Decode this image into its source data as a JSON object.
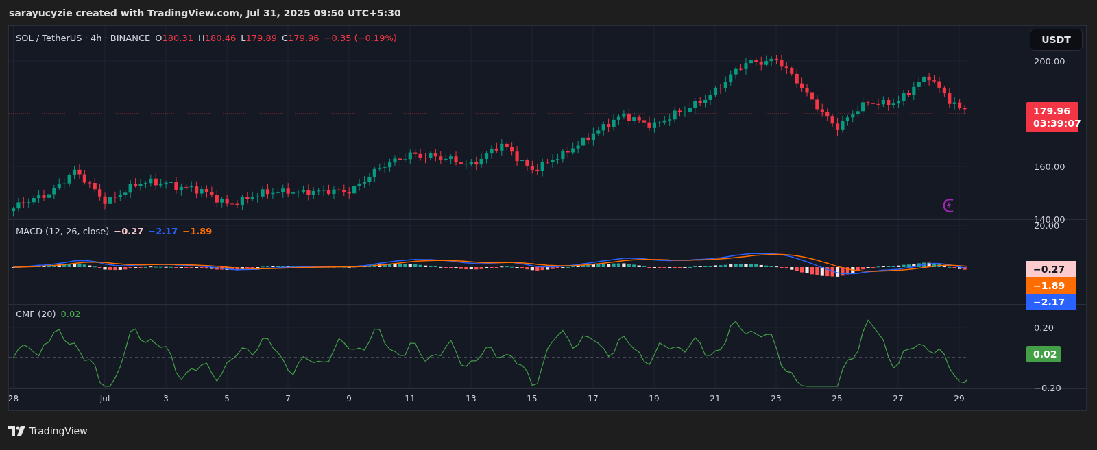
{
  "header": {
    "text": "sarayucyzie created with TradingView.com, Jul 31, 2025 09:50 UTC+5:30"
  },
  "legend": {
    "symbol": "SOL / TetherUS · 4h · BINANCE",
    "ohlc": [
      {
        "key": "O",
        "value": "180.31"
      },
      {
        "key": "H",
        "value": "180.46"
      },
      {
        "key": "L",
        "value": "179.89"
      },
      {
        "key": "C",
        "value": "179.96"
      }
    ],
    "change": "−0.35 (−0.19%)"
  },
  "currency_button": "USDT",
  "price_axis": {
    "ticks": [
      "200.00",
      "160.00",
      "140.00"
    ],
    "last_price": "179.96",
    "countdown": "03:39:07"
  },
  "macd": {
    "title": "MACD (12, 26, close)",
    "values": [
      {
        "text": "−0.27",
        "color": "#f7c9cc"
      },
      {
        "text": "−2.17",
        "color": "#2962ff"
      },
      {
        "text": "−1.89",
        "color": "#ff6d00"
      }
    ],
    "axis_tick": "20.00",
    "badges": [
      {
        "text": "−0.27",
        "color": "#fccbcd"
      },
      {
        "text": "−1.89",
        "color": "#ff6d00"
      },
      {
        "text": "−2.17",
        "color": "#2962ff"
      }
    ]
  },
  "cmf": {
    "title": "CMF (20)",
    "value": "0.02",
    "ticks": [
      "0.20",
      "−0.20"
    ],
    "badge": "0.02"
  },
  "time_axis": [
    "28",
    "Jul",
    "3",
    "5",
    "7",
    "9",
    "11",
    "13",
    "15",
    "17",
    "19",
    "21",
    "23",
    "25",
    "27",
    "29"
  ],
  "footer": {
    "brand": "TradingView"
  }
}
